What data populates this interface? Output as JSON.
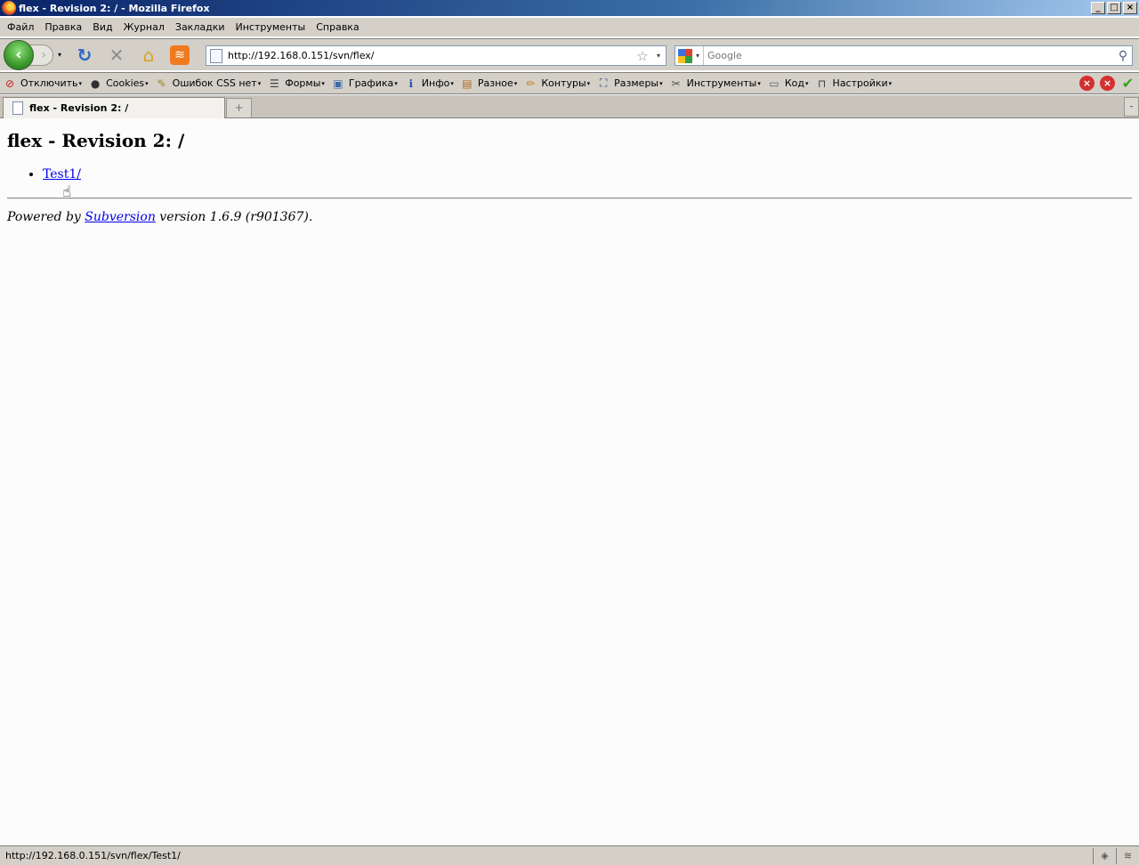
{
  "window": {
    "title": "flex - Revision 2: / - Mozilla Firefox",
    "buttons": {
      "minimize": "_",
      "maximize": "□",
      "close": "×"
    }
  },
  "menubar": {
    "items": [
      "Файл",
      "Правка",
      "Вид",
      "Журнал",
      "Закладки",
      "Инструменты",
      "Справка"
    ]
  },
  "navbar": {
    "back_glyph": "‹",
    "forward_glyph": "›",
    "dropdown_glyph": "▾",
    "reload_glyph": "↻",
    "stop_glyph": "✕",
    "home_glyph": "⌂",
    "rss_glyph": "≋",
    "url": "http://192.168.0.151/svn/flex/",
    "star_glyph": "☆",
    "search_placeholder": "Google",
    "search_glyph": "⚲"
  },
  "devbar": {
    "items": [
      {
        "label": "Отключить",
        "icon": "disable-icon",
        "glyph": "⊘"
      },
      {
        "label": "Cookies",
        "icon": "user-icon",
        "glyph": "●"
      },
      {
        "label": "Ошибок CSS нет",
        "icon": "pencil-icon",
        "glyph": "✎"
      },
      {
        "label": "Формы",
        "icon": "form-icon",
        "glyph": "☰"
      },
      {
        "label": "Графика",
        "icon": "image-icon",
        "glyph": "▣"
      },
      {
        "label": "Инфо",
        "icon": "info-icon",
        "glyph": "ℹ"
      },
      {
        "label": "Разное",
        "icon": "misc-icon",
        "glyph": "▤"
      },
      {
        "label": "Контуры",
        "icon": "outline-icon",
        "glyph": "✏"
      },
      {
        "label": "Размеры",
        "icon": "resize-icon",
        "glyph": "⛶"
      },
      {
        "label": "Инструменты",
        "icon": "tools-icon",
        "glyph": "✂"
      },
      {
        "label": "Код",
        "icon": "source-icon",
        "glyph": "▭"
      },
      {
        "label": "Настройки",
        "icon": "settings-icon",
        "glyph": "⊓"
      }
    ],
    "arrow_glyph": "▾",
    "right": {
      "error_glyph": "×",
      "warning_glyph": "×",
      "ok_glyph": "✔"
    }
  },
  "tabs": {
    "active_label": "flex - Revision 2: /",
    "new_tab_glyph": "+",
    "list_glyph": "–"
  },
  "page": {
    "heading": "flex - Revision 2: /",
    "entries": [
      "Test1/"
    ],
    "footer_prefix": "Powered by ",
    "footer_link": "Subversion",
    "footer_suffix": " version 1.6.9 (r901367)."
  },
  "cursor_glyph": "☝",
  "statusbar": {
    "text": "http://192.168.0.151/svn/flex/Test1/",
    "cell1_glyph": "◈",
    "cell2_glyph": "≋"
  },
  "colors": {
    "titlebar_start": "#0a246a",
    "chrome": "#d4d0c8",
    "link": "#0000ee",
    "back_button": "#3b9a2b",
    "rss": "#f07a1e"
  }
}
